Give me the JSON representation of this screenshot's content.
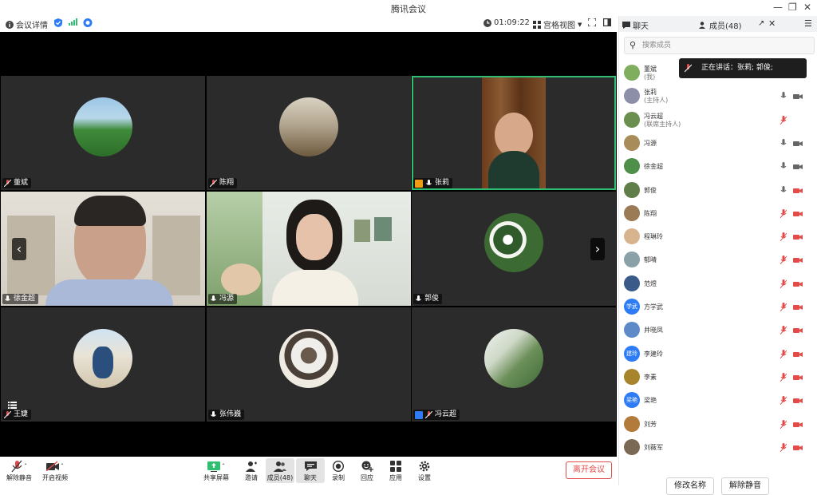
{
  "window": {
    "title": "腾讯会议"
  },
  "toolbar": {
    "meeting_info": "会议详情",
    "timer": "01:09:22",
    "view_mode": "宫格视图"
  },
  "tiles": [
    {
      "name": "董斌",
      "mic": "muted",
      "speaking": false,
      "display": "avatar"
    },
    {
      "name": "陈翔",
      "mic": "muted",
      "speaking": false,
      "display": "avatar"
    },
    {
      "name": "张莉",
      "mic": "on",
      "speaking": true,
      "host_badge": true,
      "display": "video"
    },
    {
      "name": "徐金超",
      "mic": "on",
      "speaking": false,
      "display": "video"
    },
    {
      "name": "冯源",
      "mic": "on",
      "speaking": false,
      "display": "video"
    },
    {
      "name": "郭俊",
      "mic": "on",
      "speaking": false,
      "display": "avatar"
    },
    {
      "name": "王婕",
      "mic": "muted",
      "speaking": false,
      "display": "avatar"
    },
    {
      "name": "张伟巍",
      "mic": "on",
      "speaking": false,
      "display": "avatar"
    },
    {
      "name": "冯云超",
      "mic": "muted",
      "speaking": false,
      "host_badge": true,
      "display": "avatar"
    }
  ],
  "bottom_bar": {
    "unmute": "解除静音",
    "start_video": "开启视频",
    "share_screen": "共享屏幕",
    "invite": "邀请",
    "members": "成员(48)",
    "chat": "聊天",
    "record": "录制",
    "react": "回应",
    "apps": "应用",
    "settings": "设置",
    "leave": "离开会议"
  },
  "panel": {
    "chat_tab": "聊天",
    "members_tab": "成员(48)",
    "search_placeholder": "搜索成员",
    "speaking_toast": "正在讲话：张莉; 郭俊;",
    "rename_button": "修改名称",
    "unmute_all_button": "解除静音",
    "members": [
      {
        "name": "董斌",
        "role": "(我)",
        "mic": "none",
        "cam": "none",
        "avatar_text": ""
      },
      {
        "name": "张莉",
        "role": "(主持人)",
        "mic": "on",
        "cam": "on",
        "avatar_text": ""
      },
      {
        "name": "冯云超",
        "role": "(联席主持人)",
        "mic": "muted",
        "cam": "none",
        "avatar_text": ""
      },
      {
        "name": "冯源",
        "role": "",
        "mic": "on",
        "cam": "on",
        "avatar_text": ""
      },
      {
        "name": "徐金超",
        "role": "",
        "mic": "on",
        "cam": "on",
        "avatar_text": ""
      },
      {
        "name": "郭俊",
        "role": "",
        "mic": "on",
        "cam": "off",
        "avatar_text": ""
      },
      {
        "name": "陈翔",
        "role": "",
        "mic": "muted",
        "cam": "off",
        "avatar_text": ""
      },
      {
        "name": "程琳玲",
        "role": "",
        "mic": "muted",
        "cam": "off",
        "avatar_text": ""
      },
      {
        "name": "郁晴",
        "role": "",
        "mic": "muted",
        "cam": "off",
        "avatar_text": ""
      },
      {
        "name": "范煜",
        "role": "",
        "mic": "muted",
        "cam": "off",
        "avatar_text": ""
      },
      {
        "name": "方学武",
        "role": "",
        "mic": "muted",
        "cam": "off",
        "avatar_text": "学武"
      },
      {
        "name": "井晓凤",
        "role": "",
        "mic": "muted",
        "cam": "off",
        "avatar_text": ""
      },
      {
        "name": "李建玲",
        "role": "",
        "mic": "muted",
        "cam": "off",
        "avatar_text": "建玲"
      },
      {
        "name": "李素",
        "role": "",
        "mic": "muted",
        "cam": "off",
        "avatar_text": ""
      },
      {
        "name": "梁艳",
        "role": "",
        "mic": "muted",
        "cam": "off",
        "avatar_text": "梁艳"
      },
      {
        "name": "刘芳",
        "role": "",
        "mic": "muted",
        "cam": "off",
        "avatar_text": ""
      },
      {
        "name": "刘薇军",
        "role": "",
        "mic": "muted",
        "cam": "off",
        "avatar_text": ""
      }
    ]
  },
  "colors": {
    "active_speaker": "#2fbf71",
    "muted": "#e34b4b",
    "accent": "#2d7cf6",
    "tile_bg": "#2b2b2c"
  }
}
